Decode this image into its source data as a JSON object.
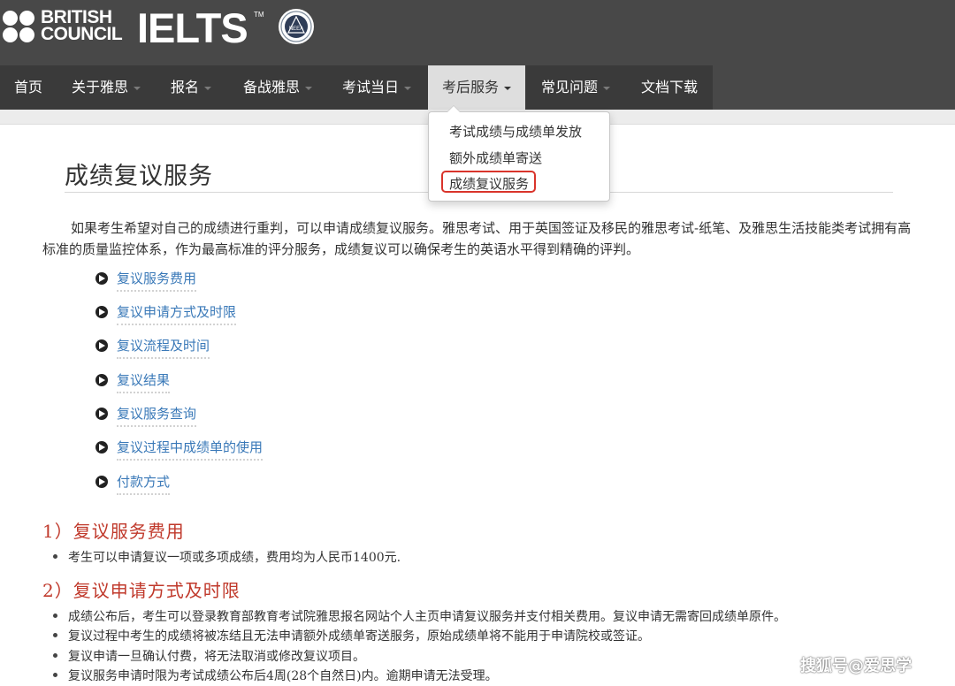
{
  "brand": {
    "bc_line1": "BRITISH",
    "bc_line2": "COUNCIL",
    "ielts": "IELTS",
    "ielts_tm": "TM",
    "seal_text": "NEEA"
  },
  "nav": {
    "items": [
      {
        "label": "首页",
        "has_caret": false
      },
      {
        "label": "关于雅思",
        "has_caret": true
      },
      {
        "label": "报名",
        "has_caret": true
      },
      {
        "label": "备战雅思",
        "has_caret": true
      },
      {
        "label": "考试当日",
        "has_caret": true
      },
      {
        "label": "考后服务",
        "has_caret": true,
        "active": true
      },
      {
        "label": "常见问题",
        "has_caret": true
      },
      {
        "label": "文档下载",
        "has_caret": false
      }
    ]
  },
  "dropdown": {
    "items": [
      {
        "label": "考试成绩与成绩单发放"
      },
      {
        "label": "额外成绩单寄送"
      },
      {
        "label": "成绩复议服务",
        "highlighted": true
      }
    ],
    "highlight_color": "#d9342b"
  },
  "main": {
    "title": "成绩复议服务",
    "intro": "如果考生希望对自己的成绩进行重判，可以申请成绩复议服务。雅思考试、用于英国签证及移民的雅思考试-纸笔、及雅思生活技能类考试拥有高标准的质量监控体系，作为最高标准的评分服务，成绩复议可以确保考生的英语水平得到精确的评判。",
    "toc": [
      "复议服务费用",
      "复议申请方式及时限",
      "复议流程及时间",
      "复议结果",
      "复议服务查询",
      "复议过程中成绩单的使用",
      "付款方式"
    ],
    "sections": [
      {
        "heading": "1）复议服务费用",
        "bullets": [
          "考生可以申请复议一项或多项成绩，费用均为人民币1400元."
        ]
      },
      {
        "heading": "2）复议申请方式及时限",
        "bullets": [
          "成绩公布后，考生可以登录教育部教育考试院雅思报名网站个人主页申请复议服务并支付相关费用。复议申请无需寄回成绩单原件。",
          "复议过程中考生的成绩将被冻结且无法申请额外成绩单寄送服务，原始成绩单将不能用于申请院校或签证。",
          "复议申请一旦确认付费，将无法取消或修改复议项目。",
          "复议服务申请时限为考试成绩公布后4周(28个自然日)内。逾期申请无法受理。"
        ]
      }
    ]
  },
  "watermark": "搜狐号@爱思学",
  "colors": {
    "header_bg": "#484848",
    "nav_bg": "#3a3a3a",
    "nav_active_bg": "#dedede",
    "link": "#3a79b8",
    "section_heading": "#c0392b"
  }
}
